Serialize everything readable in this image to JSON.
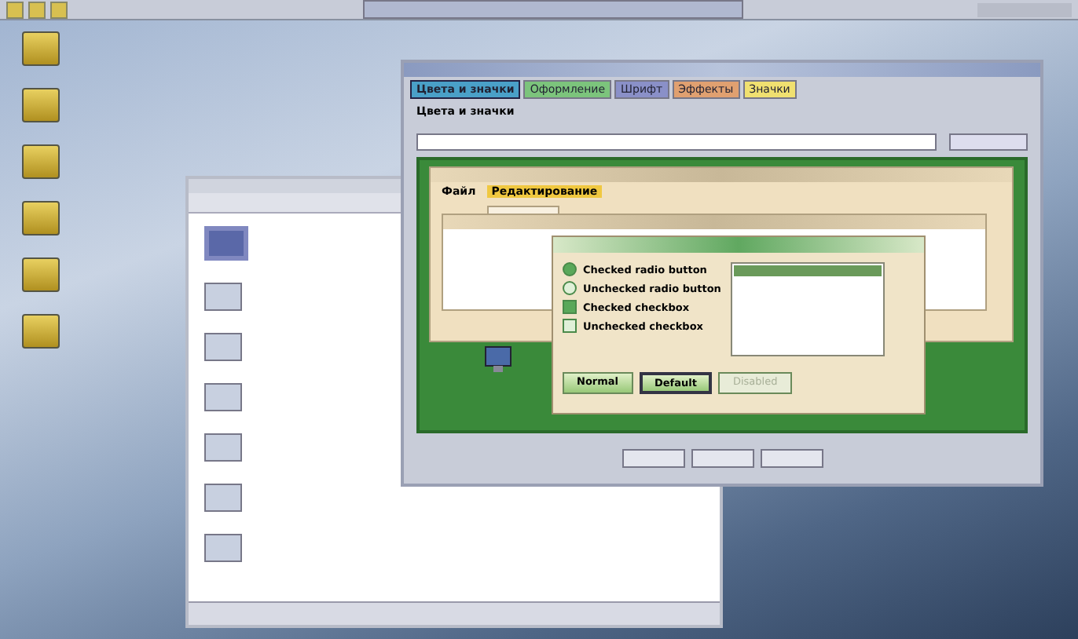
{
  "control_window": {
    "tabs": [
      {
        "label": "Цвета и значки",
        "selected": true,
        "color": "#4aa0c8"
      },
      {
        "label": "Оформление",
        "selected": false,
        "color": "#7cc47c"
      },
      {
        "label": "Шрифт",
        "selected": false,
        "color": "#8a90c8"
      },
      {
        "label": "Эффекты",
        "selected": false,
        "color": "#e0a070"
      },
      {
        "label": "Значки",
        "selected": false,
        "color": "#f0e070"
      }
    ],
    "heading": "Цвета и значки",
    "preview": {
      "menu": [
        {
          "label": "Файл",
          "selected": false
        },
        {
          "label": "Редактирование",
          "selected": true
        }
      ],
      "dialog": {
        "options": [
          {
            "kind": "radio",
            "label": "Checked radio button",
            "checked": true
          },
          {
            "kind": "radio",
            "label": "Unchecked radio button",
            "checked": false
          },
          {
            "kind": "checkbox",
            "label": "Checked checkbox",
            "checked": true
          },
          {
            "kind": "checkbox",
            "label": "Unchecked checkbox",
            "checked": false
          }
        ],
        "buttons": [
          {
            "kind": "normal",
            "label": "Normal"
          },
          {
            "kind": "default",
            "label": "Default"
          },
          {
            "kind": "disabled",
            "label": "Disabled"
          }
        ]
      }
    }
  },
  "file_window": {
    "files": [
      {
        "selected": true
      },
      {
        "selected": false
      },
      {
        "selected": false
      },
      {
        "selected": false
      },
      {
        "selected": false
      },
      {
        "selected": false
      },
      {
        "selected": false
      }
    ]
  }
}
